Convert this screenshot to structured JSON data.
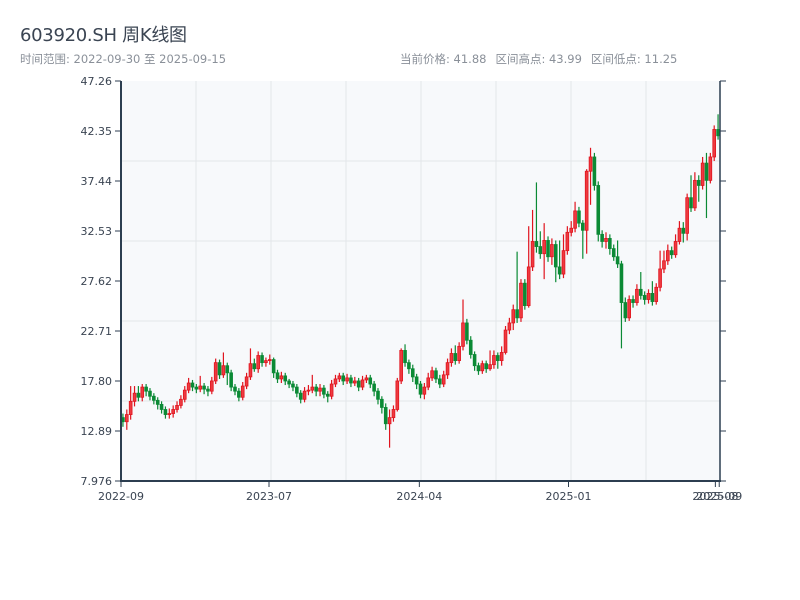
{
  "header": {
    "title": "603920.SH 周K线图",
    "range_label": "时间范围: 2022-09-30 至 2025-09-15",
    "current_price": "当前价格: 41.88",
    "period_high": "区间高点: 43.99",
    "period_low": "区间低点: 11.25"
  },
  "colors": {
    "up": "#e0141e",
    "up_fill": "#ee3a40",
    "down": "#0b8a35",
    "axis": "#2c3e50",
    "grid": "#e3e6ea",
    "plot_bg": "#f7f9fb"
  },
  "chart_data": {
    "type": "candlestick",
    "title": "603920.SH 周K线图",
    "xlabel": "",
    "ylabel": "",
    "ylim": [
      7.976,
      47.26
    ],
    "y_ticks": [
      "47.26",
      "42.35",
      "37.44",
      "32.53",
      "27.62",
      "22.71",
      "17.80",
      "12.89",
      "7.976"
    ],
    "x_ticks": [
      {
        "label": "2022-09",
        "index": 0
      },
      {
        "label": "2023-07",
        "index": 38.3
      },
      {
        "label": "2024-04",
        "index": 77.2
      },
      {
        "label": "2025-01",
        "index": 115.8
      },
      {
        "label": "2025-08",
        "index": 153.8
      },
      {
        "label": "2025-09",
        "index": 154.8
      }
    ],
    "grid": true,
    "ohlc_fields": [
      "open",
      "high",
      "low",
      "close"
    ],
    "candles": [
      [
        14.2,
        14.6,
        13.3,
        13.8
      ],
      [
        13.8,
        15.0,
        13.0,
        14.5
      ],
      [
        14.5,
        17.3,
        14.0,
        15.8
      ],
      [
        15.8,
        17.3,
        15.3,
        16.6
      ],
      [
        16.6,
        17.3,
        15.8,
        16.2
      ],
      [
        16.2,
        17.5,
        15.8,
        17.2
      ],
      [
        17.2,
        17.5,
        16.3,
        16.8
      ],
      [
        16.8,
        17.1,
        15.9,
        16.3
      ],
      [
        16.3,
        16.6,
        15.5,
        15.9
      ],
      [
        15.9,
        16.2,
        15.0,
        15.5
      ],
      [
        15.5,
        15.8,
        14.6,
        15.0
      ],
      [
        15.0,
        15.3,
        14.1,
        14.5
      ],
      [
        14.5,
        15.1,
        14.1,
        14.6
      ],
      [
        14.6,
        15.4,
        14.2,
        15.0
      ],
      [
        15.0,
        15.8,
        14.7,
        15.4
      ],
      [
        15.4,
        16.4,
        15.1,
        16.0
      ],
      [
        16.0,
        17.3,
        15.7,
        16.9
      ],
      [
        16.9,
        18.1,
        16.6,
        17.6
      ],
      [
        17.6,
        17.9,
        16.8,
        17.2
      ],
      [
        17.2,
        17.5,
        16.6,
        17.0
      ],
      [
        17.0,
        18.3,
        16.7,
        17.3
      ],
      [
        17.3,
        17.6,
        16.5,
        17.0
      ],
      [
        17.0,
        17.3,
        16.3,
        16.8
      ],
      [
        16.8,
        18.2,
        16.5,
        17.8
      ],
      [
        17.8,
        20.0,
        17.5,
        19.6
      ],
      [
        19.6,
        19.9,
        18.0,
        18.4
      ],
      [
        18.4,
        20.6,
        18.1,
        19.3
      ],
      [
        19.3,
        19.6,
        17.4,
        18.6
      ],
      [
        18.6,
        18.9,
        16.8,
        17.2
      ],
      [
        17.2,
        17.5,
        16.4,
        16.8
      ],
      [
        16.8,
        17.1,
        15.8,
        16.2
      ],
      [
        16.2,
        17.7,
        15.9,
        17.3
      ],
      [
        17.3,
        18.6,
        17.0,
        18.2
      ],
      [
        18.2,
        21.0,
        17.9,
        19.5
      ],
      [
        19.5,
        20.0,
        18.7,
        19.0
      ],
      [
        19.0,
        20.7,
        18.6,
        20.3
      ],
      [
        20.3,
        20.6,
        19.2,
        19.6
      ],
      [
        19.6,
        20.1,
        19.2,
        19.8
      ],
      [
        19.8,
        20.4,
        19.4,
        19.9
      ],
      [
        19.9,
        20.1,
        18.1,
        18.6
      ],
      [
        18.6,
        18.9,
        17.6,
        18.0
      ],
      [
        18.0,
        18.7,
        17.6,
        18.3
      ],
      [
        18.3,
        18.6,
        17.4,
        17.8
      ],
      [
        17.8,
        18.0,
        17.1,
        17.5
      ],
      [
        17.5,
        17.8,
        16.8,
        17.2
      ],
      [
        17.2,
        17.5,
        16.2,
        16.6
      ],
      [
        16.6,
        16.9,
        15.6,
        16.0
      ],
      [
        16.0,
        17.2,
        15.7,
        16.8
      ],
      [
        16.8,
        17.4,
        16.4,
        16.9
      ],
      [
        16.9,
        18.4,
        16.6,
        17.2
      ],
      [
        17.2,
        17.5,
        16.3,
        16.8
      ],
      [
        16.8,
        17.5,
        16.3,
        17.1
      ],
      [
        17.1,
        17.4,
        16.1,
        16.5
      ],
      [
        16.5,
        16.8,
        15.7,
        16.3
      ],
      [
        16.3,
        17.9,
        16.0,
        17.5
      ],
      [
        17.5,
        18.4,
        17.2,
        18.0
      ],
      [
        18.0,
        18.6,
        17.7,
        18.3
      ],
      [
        18.3,
        18.6,
        17.4,
        17.8
      ],
      [
        17.8,
        18.5,
        17.5,
        18.1
      ],
      [
        18.1,
        18.4,
        17.2,
        17.6
      ],
      [
        17.6,
        18.2,
        17.3,
        17.8
      ],
      [
        17.8,
        18.1,
        16.8,
        17.2
      ],
      [
        17.2,
        18.3,
        16.9,
        17.9
      ],
      [
        17.9,
        18.4,
        17.6,
        18.1
      ],
      [
        18.1,
        18.4,
        17.1,
        17.5
      ],
      [
        17.5,
        17.8,
        16.3,
        16.8
      ],
      [
        16.8,
        17.1,
        15.5,
        16.0
      ],
      [
        16.0,
        16.3,
        14.6,
        15.2
      ],
      [
        15.2,
        15.6,
        13.0,
        13.6
      ],
      [
        13.6,
        15.0,
        11.25,
        14.2
      ],
      [
        14.2,
        15.4,
        13.8,
        15.0
      ],
      [
        15.0,
        18.1,
        14.8,
        17.8
      ],
      [
        17.8,
        21.0,
        17.5,
        20.8
      ],
      [
        20.8,
        21.4,
        19.2,
        19.6
      ],
      [
        19.6,
        19.9,
        18.5,
        19.0
      ],
      [
        19.0,
        19.4,
        17.7,
        18.2
      ],
      [
        18.2,
        18.5,
        17.0,
        17.5
      ],
      [
        17.5,
        17.8,
        16.1,
        16.5
      ],
      [
        16.5,
        17.6,
        16.0,
        17.2
      ],
      [
        17.2,
        18.6,
        16.9,
        18.1
      ],
      [
        18.1,
        19.2,
        17.8,
        18.8
      ],
      [
        18.8,
        19.1,
        17.6,
        18.0
      ],
      [
        18.0,
        18.4,
        17.1,
        17.5
      ],
      [
        17.5,
        18.8,
        17.2,
        18.4
      ],
      [
        18.4,
        20.0,
        18.0,
        19.6
      ],
      [
        19.6,
        21.0,
        19.2,
        20.5
      ],
      [
        20.5,
        21.3,
        19.4,
        19.8
      ],
      [
        19.8,
        21.6,
        19.5,
        21.2
      ],
      [
        21.2,
        25.8,
        20.8,
        23.5
      ],
      [
        23.5,
        23.9,
        21.4,
        21.8
      ],
      [
        21.8,
        22.2,
        20.0,
        20.4
      ],
      [
        20.4,
        20.7,
        18.8,
        19.3
      ],
      [
        19.3,
        19.6,
        18.4,
        18.8
      ],
      [
        18.8,
        19.8,
        18.5,
        19.5
      ],
      [
        19.5,
        19.8,
        18.6,
        19.0
      ],
      [
        19.0,
        20.8,
        18.8,
        19.4
      ],
      [
        19.4,
        20.8,
        19.0,
        20.3
      ],
      [
        20.3,
        20.6,
        19.0,
        19.8
      ],
      [
        19.8,
        21.2,
        19.3,
        20.6
      ],
      [
        20.6,
        23.2,
        20.4,
        22.8
      ],
      [
        22.8,
        24.0,
        22.4,
        23.5
      ],
      [
        23.5,
        25.3,
        22.8,
        24.8
      ],
      [
        24.8,
        30.5,
        23.5,
        24.0
      ],
      [
        24.0,
        27.8,
        23.6,
        27.4
      ],
      [
        27.4,
        27.8,
        24.8,
        25.2
      ],
      [
        25.2,
        33.0,
        25.0,
        29.0
      ],
      [
        29.0,
        34.6,
        28.6,
        31.5
      ],
      [
        31.5,
        37.3,
        30.4,
        31.0
      ],
      [
        31.0,
        32.5,
        29.8,
        30.3
      ],
      [
        30.3,
        33.3,
        27.8,
        31.6
      ],
      [
        31.6,
        32.0,
        29.5,
        30.0
      ],
      [
        30.0,
        31.8,
        29.2,
        31.2
      ],
      [
        31.2,
        31.6,
        27.5,
        29.0
      ],
      [
        29.0,
        31.6,
        27.8,
        28.3
      ],
      [
        28.3,
        32.2,
        27.9,
        30.6
      ],
      [
        30.6,
        33.0,
        30.2,
        32.4
      ],
      [
        32.4,
        33.5,
        32.0,
        32.8
      ],
      [
        32.8,
        35.4,
        32.4,
        34.5
      ],
      [
        34.5,
        34.9,
        32.9,
        33.3
      ],
      [
        33.3,
        33.6,
        29.8,
        32.6
      ],
      [
        32.6,
        38.6,
        30.3,
        38.4
      ],
      [
        38.4,
        40.7,
        35.1,
        39.8
      ],
      [
        39.8,
        40.2,
        36.5,
        37.0
      ],
      [
        37.0,
        37.4,
        31.5,
        32.2
      ],
      [
        32.2,
        32.6,
        30.9,
        31.5
      ],
      [
        31.5,
        32.4,
        30.8,
        31.8
      ],
      [
        31.8,
        32.2,
        30.2,
        30.8
      ],
      [
        30.8,
        31.2,
        29.6,
        30.0
      ],
      [
        30.0,
        31.6,
        28.9,
        29.3
      ],
      [
        29.3,
        29.6,
        21.0,
        25.5
      ],
      [
        25.5,
        26.0,
        23.6,
        24.0
      ],
      [
        24.0,
        26.2,
        23.7,
        25.8
      ],
      [
        25.8,
        26.2,
        25.0,
        25.5
      ],
      [
        25.5,
        27.3,
        25.2,
        26.8
      ],
      [
        26.8,
        28.5,
        25.8,
        26.2
      ],
      [
        26.2,
        26.6,
        25.3,
        25.8
      ],
      [
        25.8,
        26.8,
        25.4,
        26.4
      ],
      [
        26.4,
        27.6,
        25.2,
        25.6
      ],
      [
        25.6,
        27.4,
        25.3,
        27.0
      ],
      [
        27.0,
        30.6,
        26.6,
        28.8
      ],
      [
        28.8,
        30.6,
        28.4,
        29.6
      ],
      [
        29.6,
        31.2,
        29.2,
        30.6
      ],
      [
        30.6,
        31.0,
        29.8,
        30.2
      ],
      [
        30.2,
        32.2,
        29.9,
        31.5
      ],
      [
        31.5,
        33.5,
        31.2,
        32.8
      ],
      [
        32.8,
        33.4,
        31.4,
        32.3
      ],
      [
        32.3,
        36.2,
        31.6,
        35.8
      ],
      [
        35.8,
        38.0,
        34.4,
        34.8
      ],
      [
        34.8,
        38.3,
        34.5,
        37.5
      ],
      [
        37.5,
        38.0,
        35.4,
        37.0
      ],
      [
        37.0,
        39.8,
        36.6,
        39.2
      ],
      [
        39.2,
        40.2,
        33.8,
        37.5
      ],
      [
        37.5,
        40.2,
        37.2,
        39.8
      ],
      [
        39.8,
        42.9,
        39.4,
        42.5
      ],
      [
        42.5,
        43.99,
        41.5,
        41.88
      ]
    ]
  }
}
